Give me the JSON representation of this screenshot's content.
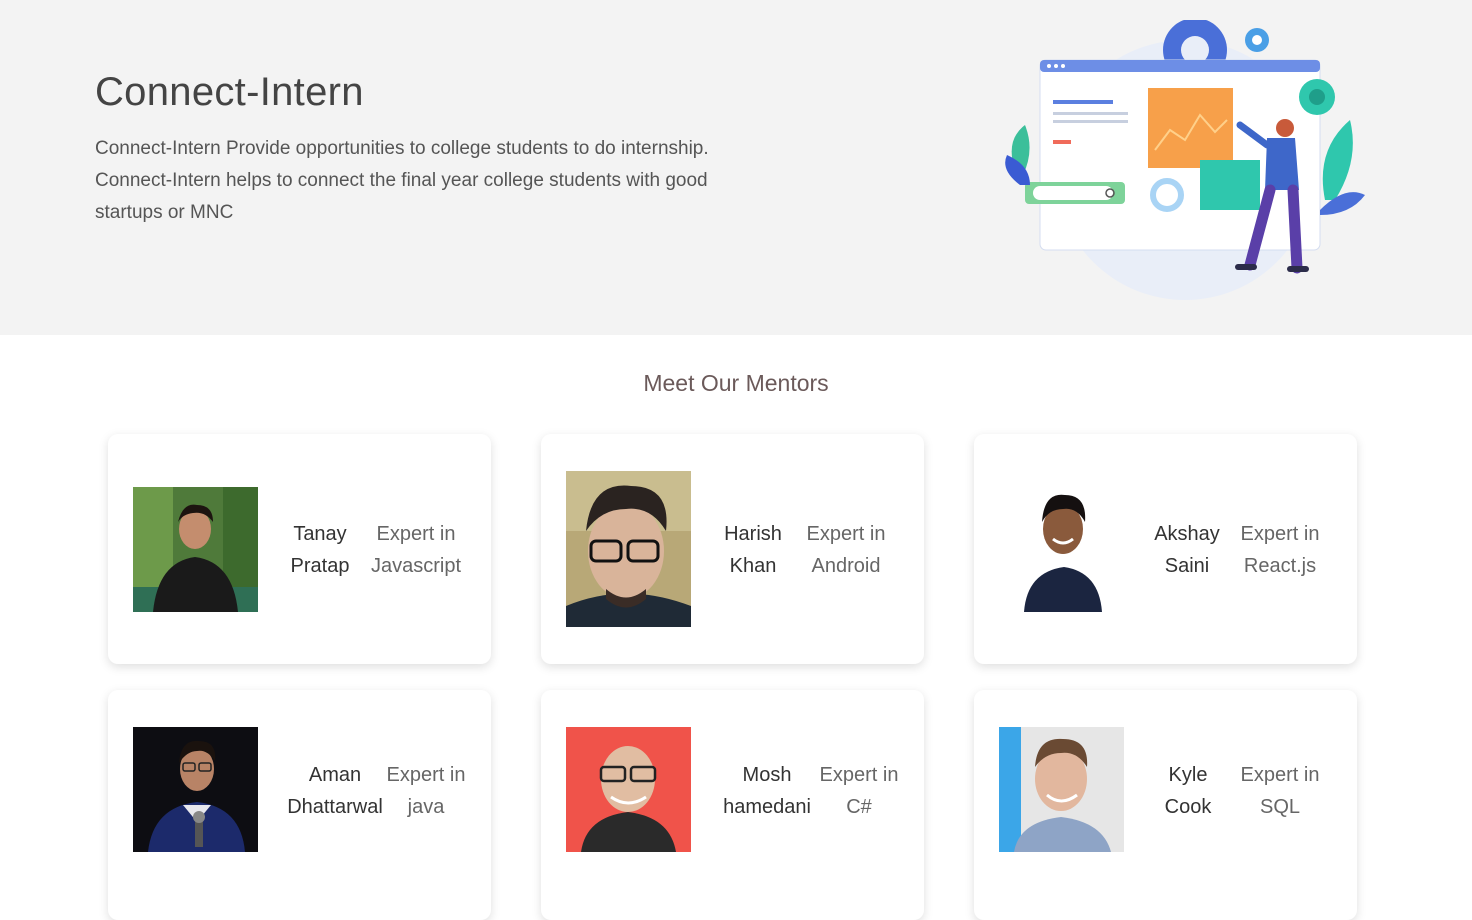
{
  "hero": {
    "title": "Connect-Intern",
    "description": "Connect-Intern Provide opportunities to college students to do internship. Connect-Intern helps to connect the final year college students with good startups or MNC"
  },
  "mentors_section": {
    "title": "Meet Our Mentors",
    "mentors": [
      {
        "name": "Tanay Pratap",
        "expertise_label": "Expert in",
        "expertise": "Javascript"
      },
      {
        "name": "Harish Khan",
        "expertise_label": "Expert in",
        "expertise": "Android"
      },
      {
        "name": "Akshay Saini",
        "expertise_label": "Expert in",
        "expertise": "React.js"
      },
      {
        "name": "Aman Dhattarwal",
        "expertise_label": "Expert in",
        "expertise": "java"
      },
      {
        "name": "Mosh hamedani",
        "expertise_label": "Expert in",
        "expertise": "C#"
      },
      {
        "name": "Kyle Cook",
        "expertise_label": "Expert in",
        "expertise": "SQL"
      }
    ]
  },
  "colors": {
    "hero_bg": "#f3f3f3",
    "section_title": "#6b5a5a",
    "illustration_primary": "#4a6fd8",
    "illustration_accent": "#f7a04a",
    "illustration_teal": "#2fc7ad"
  }
}
